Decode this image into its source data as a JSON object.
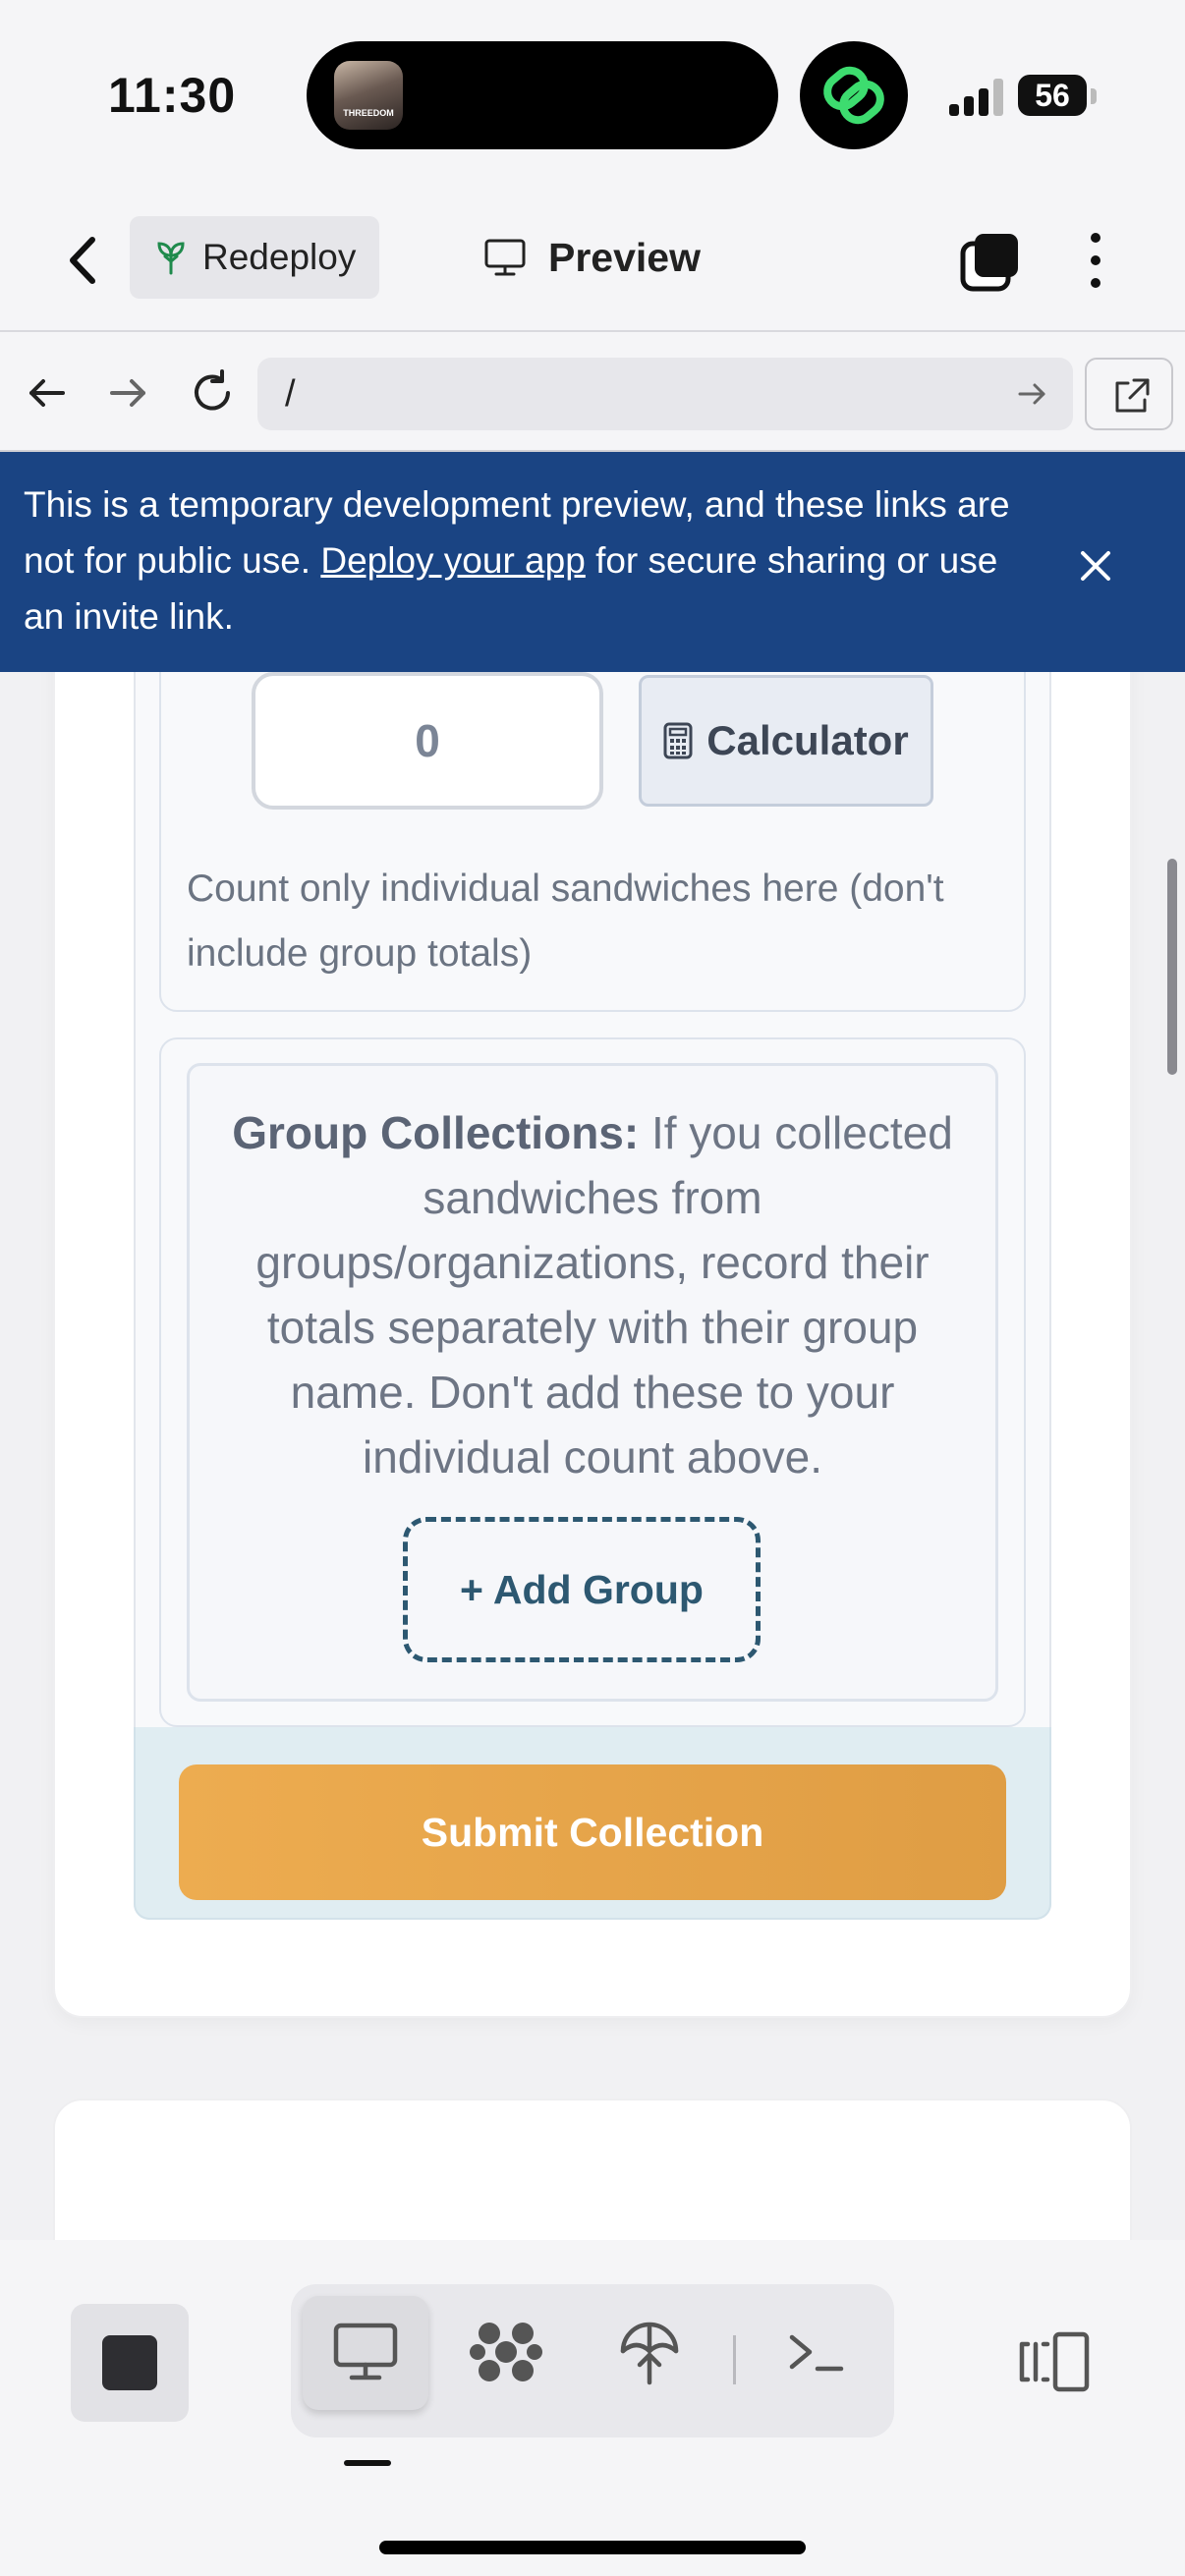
{
  "status_bar": {
    "time": "11:30",
    "now_playing_thumb_text": "THREEDOM",
    "battery": "56"
  },
  "header": {
    "redeploy_label": "Redeploy",
    "preview_label": "Preview"
  },
  "browser": {
    "url": "/"
  },
  "banner": {
    "text_before": "This is a temporary development preview, and these links are not for public use. ",
    "link_text": "Deploy your app",
    "text_after": " for secure sharing or use an invite link."
  },
  "form": {
    "individual_count_value": "0",
    "calculator_label": "Calculator",
    "count_hint": "Count only individual sandwiches here (don't include group totals)",
    "group_title": "Group Collections:",
    "group_description": " If you collected sandwiches from groups/organizations, record their totals separately with their group name. Don't add these to your individual count above.",
    "add_group_label": "+ Add Group",
    "submit_label": "Submit Collection"
  },
  "colors": {
    "banner_bg": "#1a4483",
    "submit_bg": "#e6a54a",
    "add_group_accent": "#2d5871"
  },
  "icons": {
    "header": [
      "chevron-left-icon",
      "sprout-icon",
      "monitor-icon",
      "stack-icon",
      "more-vertical-icon"
    ],
    "browser": [
      "arrow-left-icon",
      "arrow-right-icon",
      "reload-icon",
      "go-arrow-icon",
      "open-external-icon"
    ],
    "toolbar": [
      "stop-icon",
      "monitor-icon",
      "grid-blob-icon",
      "deploy-icon",
      "terminal-icon",
      "panel-toggle-icon"
    ]
  }
}
